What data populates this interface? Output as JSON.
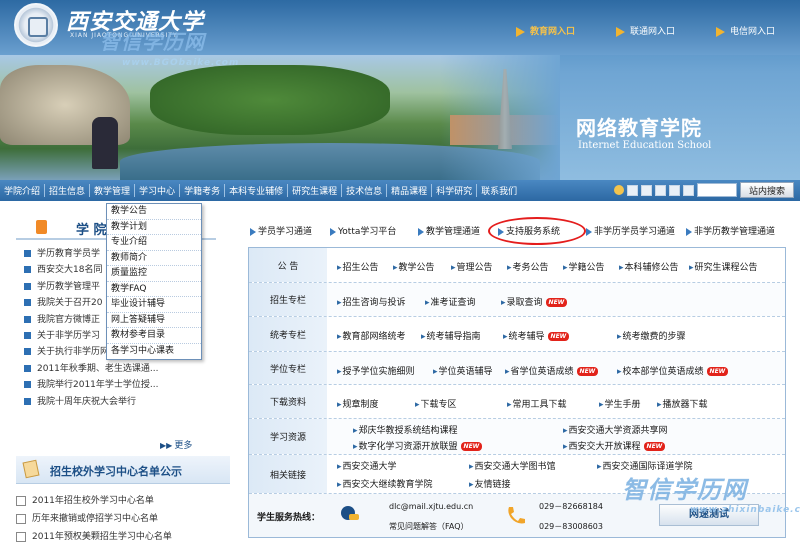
{
  "header": {
    "university_name": "西安交通大学",
    "university_en": "XIAN JIAOTONG UNIVERSITY",
    "watermark_top": "智信学历网",
    "watermark_top_url": "www.BGObaike.com",
    "entries": [
      "教育网入口",
      "联通网入口",
      "电信网入口"
    ],
    "banner_title": "网络教育学院",
    "banner_subtitle": "Internet Education School"
  },
  "nav": {
    "items": [
      "学院介绍",
      "招生信息",
      "教学管理",
      "学习中心",
      "学籍考务",
      "本科专业辅修",
      "研究生课程",
      "技术信息",
      "精品课程",
      "科学研究",
      "联系我们"
    ],
    "search_button": "站内搜索"
  },
  "dropdown": {
    "items": [
      "教学公告",
      "教学计划",
      "专业介绍",
      "教师简介",
      "质量监控",
      "教学FAQ",
      "毕业设计辅导",
      "网上答疑辅导",
      "教材参考目录",
      "各学习中心课表"
    ]
  },
  "left": {
    "college_title": "学 院",
    "news": [
      "学历教育学员学",
      "西安交大18名同",
      "学历教学管理平",
      "我院关于召开20",
      "我院官方微博正",
      "关于非学历学习",
      "关于执行非学历网络教学管理办法",
      "2011年秋季期、老生选课通...",
      "我院举行2011年学士学位授...",
      "我院十周年庆祝大会举行"
    ],
    "more": "更多",
    "center_title": "招生校外学习中心名单公示",
    "center_list": [
      "2011年招生校外学习中心名单",
      "历年来撤销或停招学习中心名单",
      "2011年预权美颗招生学习中心名单"
    ]
  },
  "quick_links": [
    "学员学习通道",
    "Yotta学习平台",
    "教学管理通道",
    "支持服务系统",
    "非学历学员学习通道",
    "非学历教学管理通道"
  ],
  "panel": {
    "rows": [
      {
        "label": "公  告",
        "links": [
          "招生公告",
          "教学公告",
          "管理公告",
          "考务公告",
          "学籍公告",
          "本科辅修公告",
          "研究生课程公告"
        ]
      },
      {
        "label": "招生专栏",
        "links": [
          "招生咨询与投诉",
          "准考证查询",
          "录取查询"
        ]
      },
      {
        "label": "统考专栏",
        "links": [
          "教育部网络统考",
          "统考辅导指南",
          "统考辅导",
          "统考缴费的步骤"
        ]
      },
      {
        "label": "学位专栏",
        "links": [
          "授予学位实施细则",
          "学位英语辅导",
          "省学位英语成绩",
          "校本部学位英语成绩"
        ]
      },
      {
        "label": "下载资料",
        "links": [
          "规章制度",
          "下载专区",
          "常用工具下载",
          "学生手册",
          "播放器下载"
        ]
      },
      {
        "label": "学习资源",
        "links": [
          "郑庆华教授系统结构课程",
          "数字化学习资源开放联盟",
          "西安交通大学资源共享网",
          "西安交大开放课程"
        ]
      },
      {
        "label": "相关链接",
        "links": [
          "西安交通大学",
          "西安交通大学图书馆",
          "西安交通国际译道学院",
          "西安交大继续教育学院",
          "友情链接"
        ]
      }
    ],
    "new_badge": "NEW"
  },
  "service": {
    "label": "学生服务热线：",
    "email": "dlc@mail.xjtu.edu.cn",
    "faq": "常见问题解答（FAQ）",
    "phone1": "029－82668184",
    "phone2": "029－83008603",
    "speedtest": "网速测试"
  },
  "watermark_bottom": "智信学历网",
  "watermark_bottom_url": "www.zhixinbaike.com"
}
